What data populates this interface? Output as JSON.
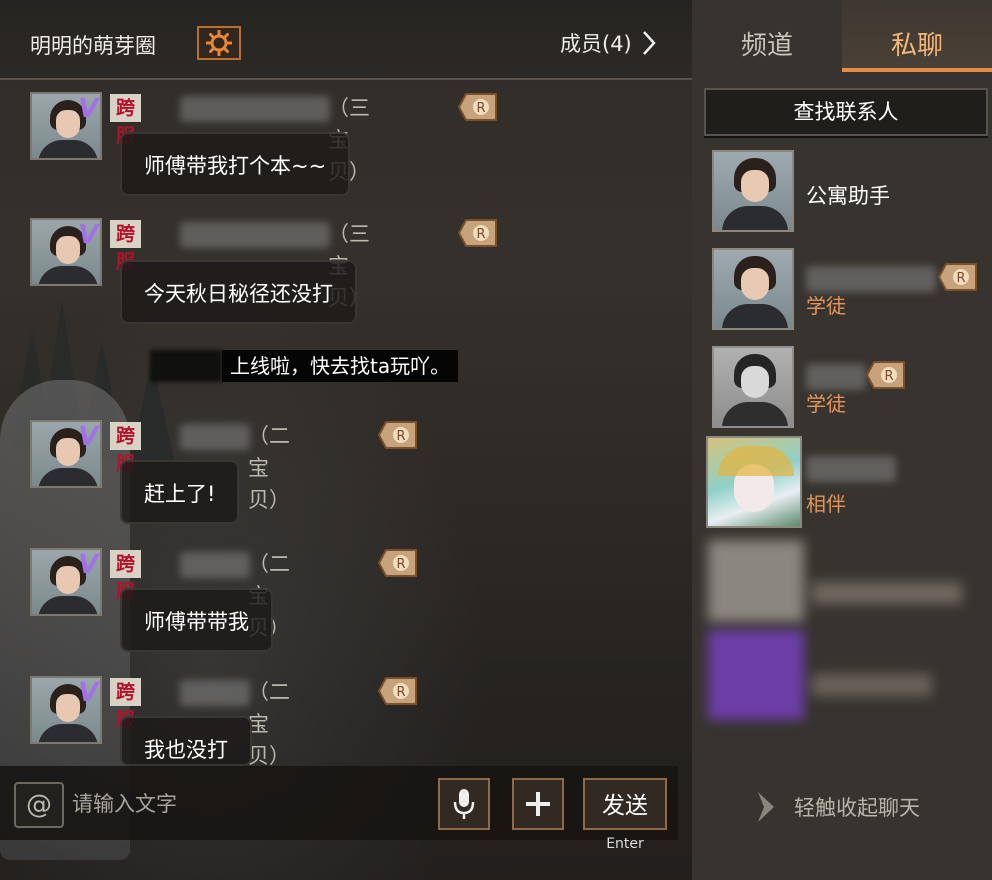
{
  "header": {
    "group_title": "明明的萌芽圈",
    "members_label": "成员(4)"
  },
  "messages": [
    {
      "cross_label": "跨服",
      "relation": "（三宝贝）",
      "text": "师傅带我打个本~~"
    },
    {
      "cross_label": "跨服",
      "relation": "（三宝贝）",
      "text": "今天秋日秘径还没打"
    },
    {
      "cross_label": "跨服",
      "relation": "（二宝贝）",
      "text": "赶上了!"
    },
    {
      "cross_label": "跨服",
      "relation": "（二宝贝）",
      "text": "师傅带带我"
    },
    {
      "cross_label": "跨服",
      "relation": "（二宝贝）",
      "text": "我也没打"
    }
  ],
  "system_message": "上线啦，快去找ta玩吖。",
  "input": {
    "at_label": "@",
    "placeholder": "请输入文字",
    "send_label": "发送",
    "send_hint": "Enter"
  },
  "right_panel": {
    "tabs": [
      {
        "label": "频道",
        "active": false
      },
      {
        "label": "私聊",
        "active": true
      }
    ],
    "find_contact_label": "查找联系人",
    "contacts": [
      {
        "name": "公寓助手",
        "tag": ""
      },
      {
        "name": "",
        "tag": "学徒"
      },
      {
        "name": "",
        "tag": "学徒"
      },
      {
        "name": "",
        "tag": "相伴"
      }
    ],
    "collapse_label": "轻触收起聊天"
  },
  "icons": {
    "gear": "gear-icon",
    "chevron": "chevron-right-icon",
    "mic": "microphone-icon",
    "plus": "plus-icon",
    "badge": "master-badge-icon"
  },
  "colors": {
    "accent": "#e08f4a",
    "cross_server_text": "#b3122b",
    "tag": "#e4955a",
    "vip_mark": "#a072e8"
  }
}
